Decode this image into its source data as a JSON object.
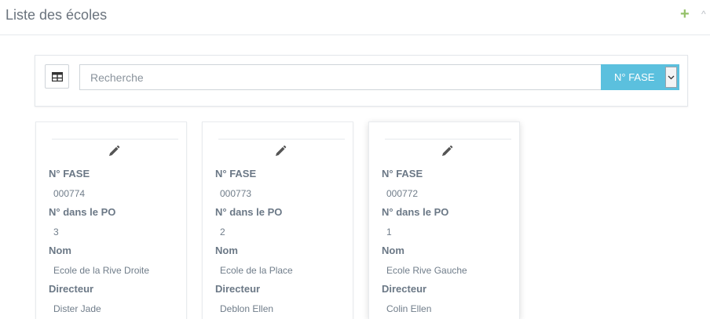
{
  "header": {
    "title": "Liste des écoles",
    "add_icon": "plus-icon",
    "collapse_icon": "chevron-up-icon"
  },
  "search": {
    "grid_icon": "table-icon",
    "placeholder": "Recherche",
    "value": "",
    "filter_selected": "N° FASE"
  },
  "colors": {
    "accent": "#5bc0de",
    "add": "#95c16a"
  },
  "cards": [
    {
      "edit_icon": "pencil-icon",
      "fase_label": "N° FASE",
      "fase_value": "000774",
      "po_label": "N° dans le PO",
      "po_value": "3",
      "nom_label": "Nom",
      "nom_value": "Ecole de la Rive Droite",
      "directeur_label": "Directeur",
      "directeur_value": "Dister Jade"
    },
    {
      "edit_icon": "pencil-icon",
      "fase_label": "N° FASE",
      "fase_value": "000773",
      "po_label": "N° dans le PO",
      "po_value": "2",
      "nom_label": "Nom",
      "nom_value": "Ecole de la Place",
      "directeur_label": "Directeur",
      "directeur_value": "Deblon Ellen"
    },
    {
      "edit_icon": "pencil-icon",
      "fase_label": "N° FASE",
      "fase_value": "000772",
      "po_label": "N° dans le PO",
      "po_value": "1",
      "nom_label": "Nom",
      "nom_value": "Ecole Rive Gauche",
      "directeur_label": "Directeur",
      "directeur_value": "Colin Ellen"
    }
  ]
}
